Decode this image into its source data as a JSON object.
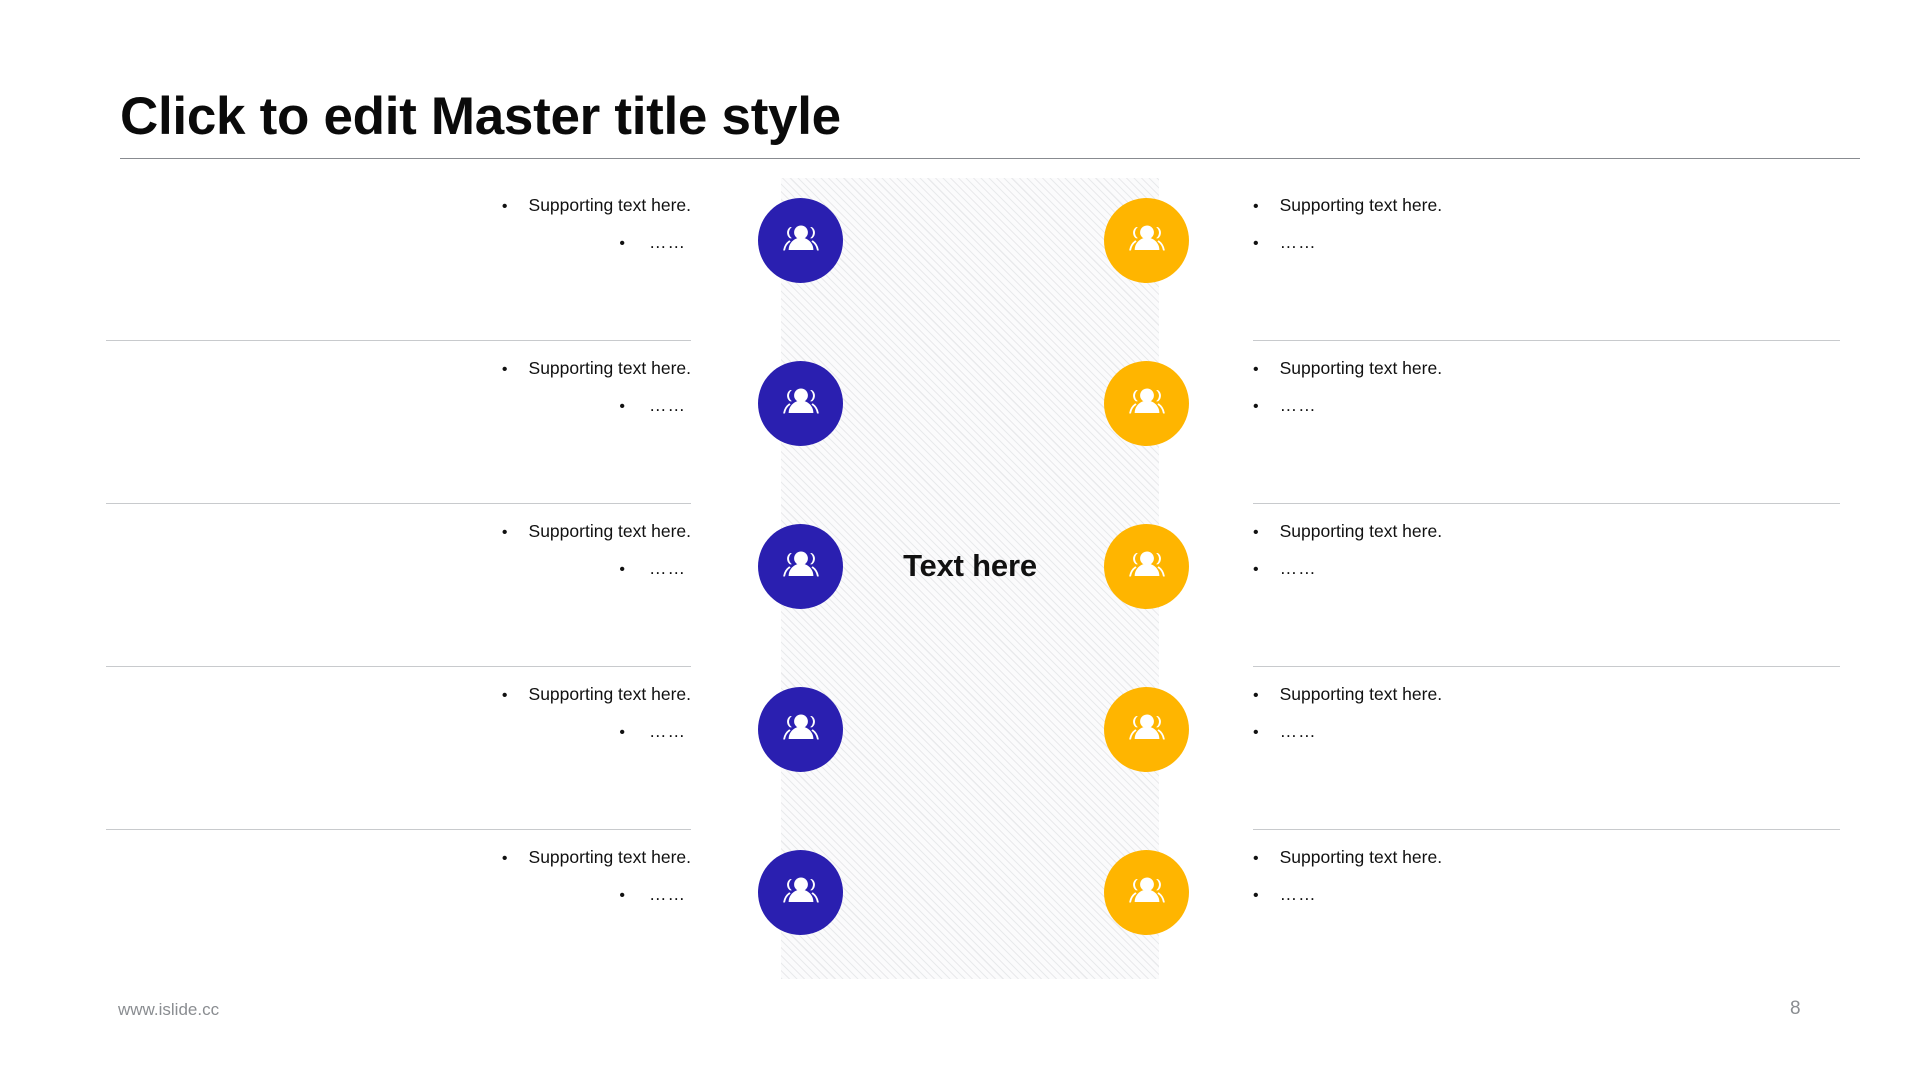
{
  "slide": {
    "title": "Click to edit Master title style",
    "center_label": "Text here",
    "accent_blue": "#2A1FB0",
    "accent_amber": "#FFB500",
    "rule_color": "#888b90",
    "divider_color": "#c8cacd"
  },
  "footer": {
    "url": "www.islide.cc",
    "page_number": "8"
  },
  "icons": {
    "blue_icon_name": "people-group-icon",
    "amber_icon_name": "people-group-icon"
  },
  "rows": [
    {
      "left": {
        "bullet_1": "Supporting  text here.",
        "bullet_2": "……"
      },
      "right": {
        "bullet_1": "Supporting  text here.",
        "bullet_2": "……"
      }
    },
    {
      "left": {
        "bullet_1": "Supporting  text here.",
        "bullet_2": "……"
      },
      "right": {
        "bullet_1": "Supporting  text here.",
        "bullet_2": "……"
      }
    },
    {
      "left": {
        "bullet_1": "Supporting  text here.",
        "bullet_2": "……"
      },
      "right": {
        "bullet_1": "Supporting  text here.",
        "bullet_2": "……"
      }
    },
    {
      "left": {
        "bullet_1": "Supporting  text here.",
        "bullet_2": "……"
      },
      "right": {
        "bullet_1": "Supporting  text here.",
        "bullet_2": "……"
      }
    },
    {
      "left": {
        "bullet_1": "Supporting  text here.",
        "bullet_2": "……"
      },
      "right": {
        "bullet_1": "Supporting  text here.",
        "bullet_2": "……"
      }
    }
  ],
  "bullet_glyph": "•"
}
